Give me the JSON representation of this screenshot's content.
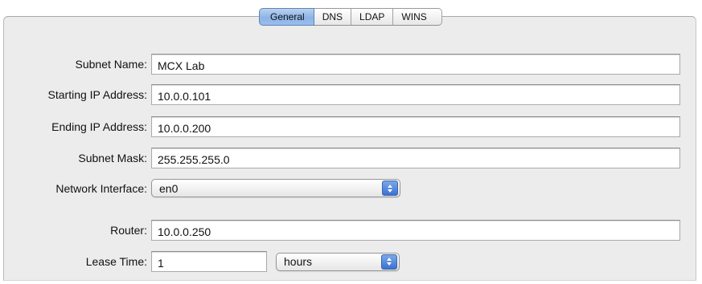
{
  "tabs": [
    {
      "label": "General",
      "selected": true
    },
    {
      "label": "DNS",
      "selected": false
    },
    {
      "label": "LDAP",
      "selected": false
    },
    {
      "label": "WINS",
      "selected": false
    }
  ],
  "form": {
    "subnet_name": {
      "label": "Subnet Name:",
      "value": "MCX Lab"
    },
    "starting_ip": {
      "label": "Starting IP Address:",
      "value": "10.0.0.101"
    },
    "ending_ip": {
      "label": "Ending IP Address:",
      "value": "10.0.0.200"
    },
    "subnet_mask": {
      "label": "Subnet Mask:",
      "value": "255.255.255.0"
    },
    "network_interface": {
      "label": "Network Interface:",
      "value": "en0",
      "icon": "popup-arrows-icon"
    },
    "router": {
      "label": "Router:",
      "value": "10.0.0.250"
    },
    "lease_time": {
      "label": "Lease Time:",
      "value": "1",
      "unit": "hours",
      "icon": "popup-arrows-icon"
    }
  },
  "colors": {
    "selected_tab": "#8db3e6",
    "popup_arrows": "#3a72d3",
    "panel_background": "#ececec"
  }
}
